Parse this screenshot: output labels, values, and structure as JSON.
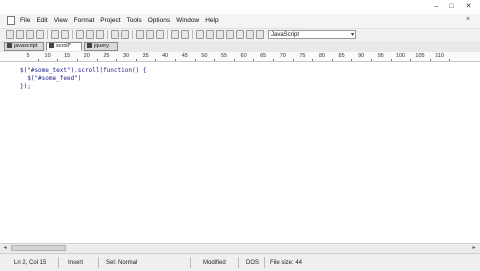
{
  "menubar": {
    "items": [
      "File",
      "Edit",
      "View",
      "Format",
      "Project",
      "Tools",
      "Options",
      "Window",
      "Help"
    ],
    "close_glyph": "×"
  },
  "window_controls": {
    "minimize": "‒",
    "maximize": "□",
    "close": "✕"
  },
  "toolbar": {
    "icons": [
      "new-file-icon",
      "open-folder-icon",
      "save-icon",
      "save-all-icon",
      "print-icon",
      "print-preview-icon",
      "cut-icon",
      "copy-icon",
      "paste-icon",
      "undo-icon",
      "redo-icon",
      "find-icon",
      "replace-icon",
      "find-in-files-icon",
      "document-icon",
      "spellcheck-icon",
      "word-wrap-icon",
      "list-icon"
    ],
    "language": "JavaScript",
    "language_arrow": "▾"
  },
  "tabs": [
    {
      "label": "javascript",
      "active": false
    },
    {
      "label": "scroll*",
      "active": true
    },
    {
      "label": "jquery",
      "active": false
    }
  ],
  "ruler": {
    "labels": [
      "5",
      "10",
      "15",
      "20",
      "25",
      "30",
      "35",
      "40",
      "45",
      "50",
      "55",
      "60",
      "65",
      "70",
      "75",
      "80",
      "85",
      "90",
      "95",
      "100",
      "105",
      "110"
    ]
  },
  "code": {
    "lines": [
      "$(\"#some_text\").scroll(function() {",
      "  $(\"#some_feed\")",
      "});"
    ]
  },
  "scrollbar": {
    "left_arrow": "◂",
    "right_arrow": "▸"
  },
  "statusbar": {
    "position": "Ln 2, Col 15",
    "insert": "Insert",
    "selection": "Sel: Normal",
    "modified": "Modified",
    "encoding": "DOS",
    "file_size": "File size: 44"
  }
}
